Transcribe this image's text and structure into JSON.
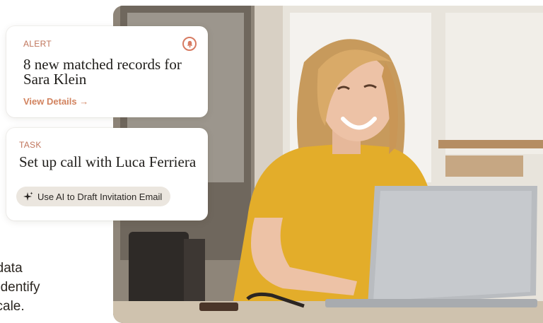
{
  "alert_card": {
    "eyebrow": "ALERT",
    "headline": "8 new matched records for Sara Klein",
    "link": "View Details",
    "link_arrow": "→",
    "icon": "bell-icon"
  },
  "task_card": {
    "eyebrow": "TASK",
    "headline": "Set up call with Luca Ferriera",
    "ai_button": "Use AI to Draft Invitation Email",
    "ai_icon": "sparkle-icon"
  },
  "hero_copy": {
    "lines": [
      "me data",
      "ns identify",
      "scale."
    ]
  },
  "colors": {
    "accent": "#d2835f",
    "eyebrow": "#c0755b",
    "pill_bg": "#ebe6df",
    "shirt": "#e3ad2a"
  }
}
